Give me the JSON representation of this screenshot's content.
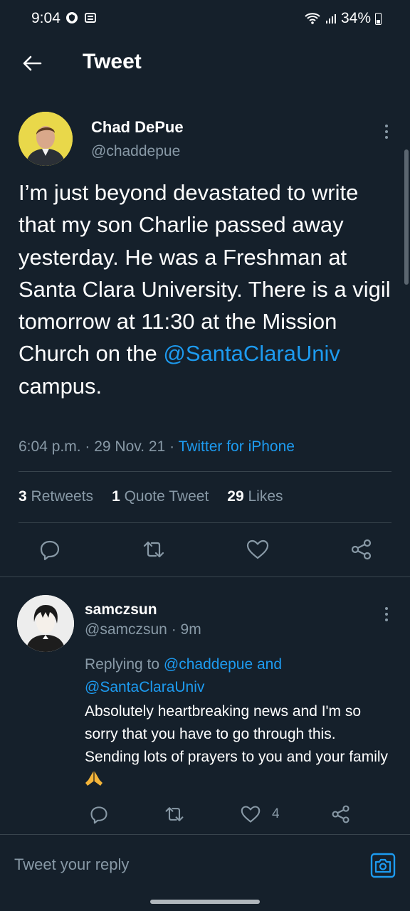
{
  "status_bar": {
    "time": "9:04",
    "battery": "34%",
    "icons": [
      "vpn-icon",
      "news-icon",
      "wifi-icon",
      "signal-icon",
      "battery-icon"
    ]
  },
  "header": {
    "title": "Tweet",
    "back_icon": "arrow-left-icon"
  },
  "tweet": {
    "author_name": "Chad DePue",
    "author_handle": "@chaddepue",
    "text_before_mention": "I’m just beyond devastated to write that my son Charlie passed away yesterday. He was a Freshman at Santa Clara University. There is a vigil tomorrow at 11:30 at the Mission Church on the ",
    "mention": "@SantaClaraUniv",
    "text_after_mention": " campus.",
    "time": "6:04 p.m.",
    "sep1": " · ",
    "date": "29 Nov. 21",
    "sep2": " · ",
    "source": "Twitter for iPhone",
    "stats": {
      "retweets_count": "3",
      "retweets_label": " Retweets",
      "quotes_count": "1",
      "quotes_label": " Quote Tweet",
      "likes_count": "29",
      "likes_label": " Likes"
    }
  },
  "reply": {
    "author_name": "samczsun",
    "author_handle": "@samczsun",
    "age": " · 9m",
    "replying_to_label": "Replying to ",
    "replying_to_1": "@chaddepue",
    "replying_and": " and",
    "replying_to_2": "@SantaClaraUniv",
    "text": "Absolutely heartbreaking news and I'm so sorry that you have to go through this. Sending lots of prayers to you and your family ",
    "like_count": "4"
  },
  "composer": {
    "placeholder": "Tweet your reply"
  },
  "colors": {
    "background": "#15202b",
    "link": "#1d9bf0",
    "secondary_text": "#8899a6",
    "divider": "#38444d"
  }
}
